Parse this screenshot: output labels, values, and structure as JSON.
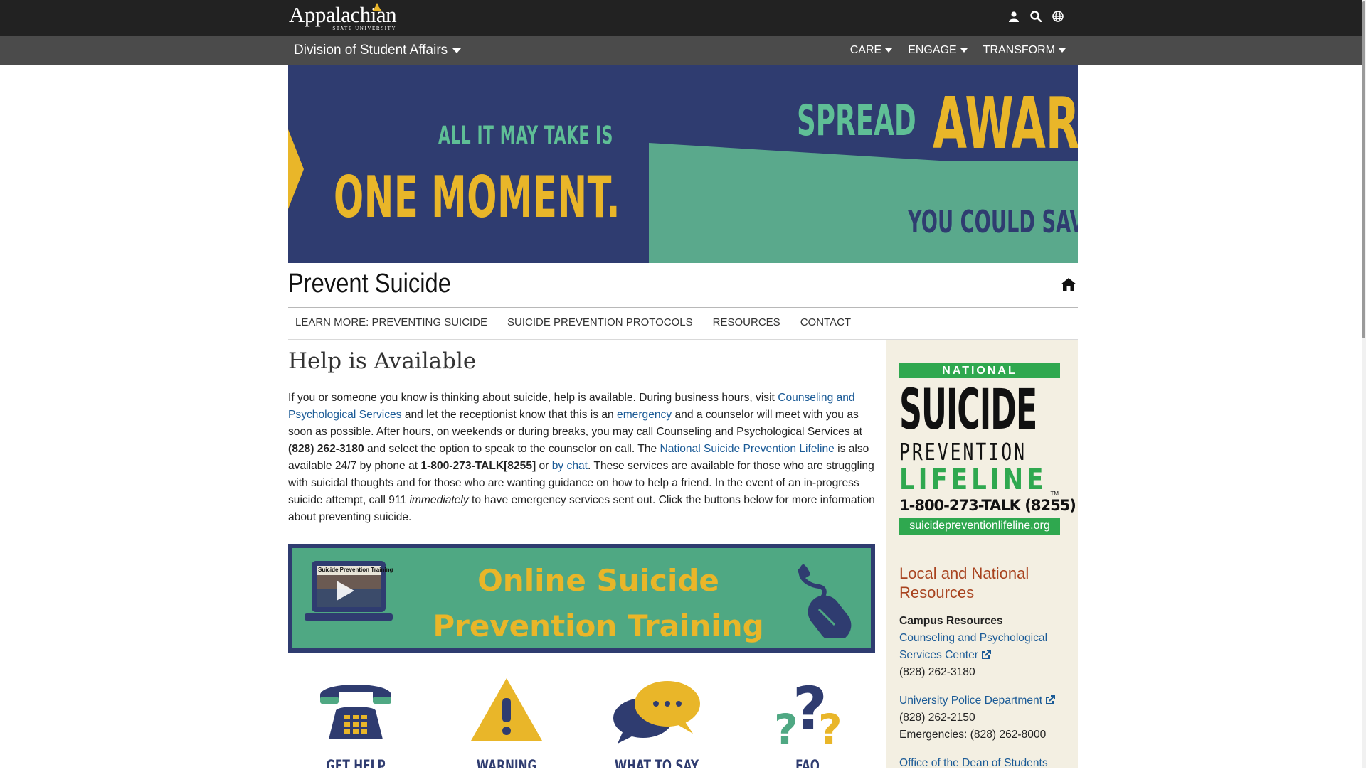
{
  "header": {
    "logo_text": "Appalachian",
    "logo_sub": "STATE UNIVERSITY",
    "icons": [
      "user-icon",
      "search-icon",
      "globe-icon"
    ]
  },
  "subnav_bar": {
    "division": "Division of Student Affairs",
    "menu": [
      "CARE",
      "ENGAGE",
      "TRANSFORM"
    ]
  },
  "hero": {
    "line1": "ALL IT MAY TAKE IS",
    "line2": "ONE MOMENT.",
    "right1": "SPREAD",
    "right2": "AWAR",
    "right3": "YOU COULD SAV"
  },
  "page": {
    "title": "Prevent Suicide",
    "tabs": [
      "LEARN MORE: PREVENTING SUICIDE",
      "SUICIDE PREVENTION PROTOCOLS",
      "RESOURCES",
      "CONTACT"
    ]
  },
  "main": {
    "heading": "Help is Available",
    "intro": {
      "t1": "If you or someone you know is thinking about suicide, help is available. During business hours, visit ",
      "link1": "Counseling and Psychological Services",
      "t2": " and let the receptionist know that this is an ",
      "link2": "emergency",
      "t3": " and a counselor will meet with you as soon as possible. After hours, on weekends or during breaks, you may call Counseling and Psychological Services at ",
      "phone1": "(828) 262-3180",
      "t4": " and select the option to speak to the counselor on call. The ",
      "link3": "National Suicide Prevention Lifeline",
      "t5": " is also available 24/7 by phone at ",
      "phone2": "1-800-273-TALK[8255]",
      "t6": " or ",
      "link4": "by chat",
      "t7": ". These services are available for those who are struggling with suicidal thoughts and for those who are wanting guidance on how to help a friend. In the event of an in-progress suicide attempt, call 911 ",
      "em": "immediately",
      "t8": " to have emergency services sent out. Click the buttons below for more information about preventing suicide."
    },
    "training_banner": {
      "line1": "Online Suicide",
      "line2": "Prevention Training",
      "screen_title": "Suicide Prevention Training"
    },
    "icon_buttons": [
      "GET HELP",
      "WARNING SIGNS",
      "WHAT TO SAY",
      "FAQ"
    ]
  },
  "sidebar": {
    "lifeline": {
      "national": "NATIONAL",
      "suicide": "SUICIDE",
      "prevention": "PREVENTION",
      "lifeline": "LIFELINE",
      "tm": "TM",
      "phone": "1-800-273-TALK (8255)",
      "url": "suicidepreventionlifeline.org"
    },
    "heading": "Local and National Resources",
    "campus_label": "Campus Resources",
    "resources": [
      {
        "name": "Counseling and Psychological Services Center",
        "phone": "(828) 262-3180"
      },
      {
        "name": "University Police Department",
        "phone": "(828) 262-2150",
        "extra": "Emergencies: (828) 262-8000"
      },
      {
        "name": "Office of the Dean of Students"
      }
    ]
  },
  "colors": {
    "navy": "#2f3c70",
    "gold": "#e9b629",
    "teal": "#5aa98c",
    "link": "#1a5a96",
    "resource_heading": "#a8431f",
    "lifeline_green": "#2fa84f"
  }
}
